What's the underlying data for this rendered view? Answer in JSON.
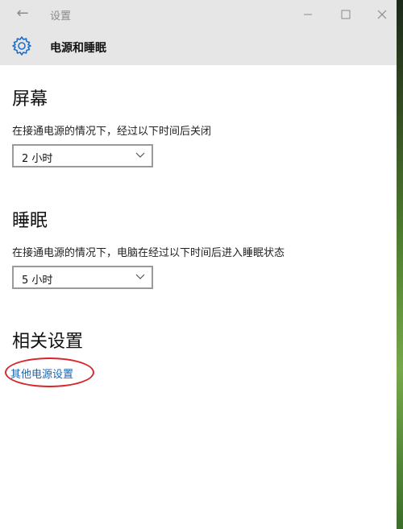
{
  "titlebar": {
    "back_icon": "back-arrow-icon",
    "title": "设置",
    "minimize_icon": "minimize-icon",
    "maximize_icon": "maximize-icon",
    "close_icon": "close-icon"
  },
  "header": {
    "icon": "gear-icon",
    "title": "电源和睡眠"
  },
  "screen_section": {
    "title": "屏幕",
    "description": "在接通电源的情况下，经过以下时间后关闭",
    "dropdown_value": "2 小时"
  },
  "sleep_section": {
    "title": "睡眠",
    "description": "在接通电源的情况下，电脑在经过以下时间后进入睡眠状态",
    "dropdown_value": "5 小时"
  },
  "related_section": {
    "title": "相关设置",
    "link": "其他电源设置"
  },
  "colors": {
    "titlebar_bg": "#e6e6e6",
    "link": "#1a64b0",
    "annotation_circle": "#d8262b",
    "gear": "#1e6fc9"
  }
}
